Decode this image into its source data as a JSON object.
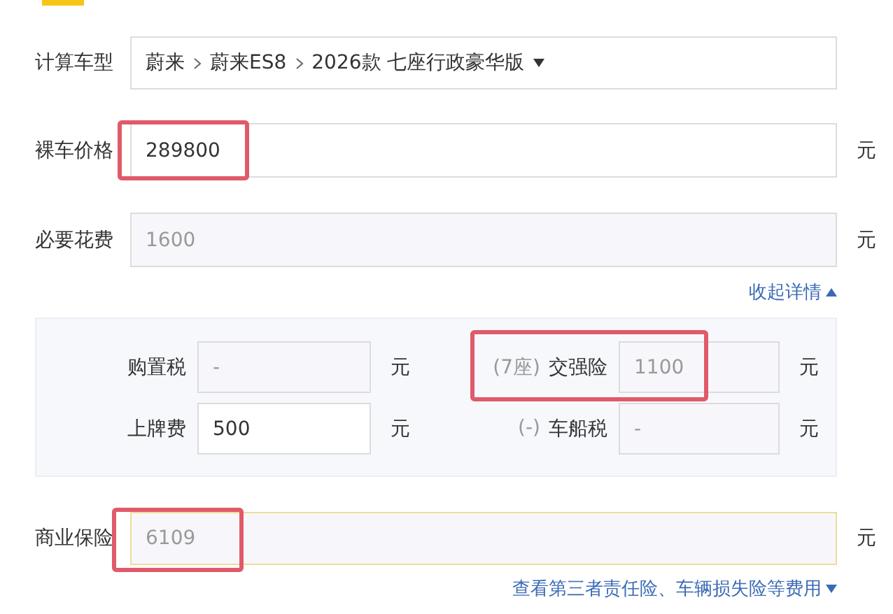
{
  "model_row": {
    "label": "计算车型",
    "path": [
      "蔚来",
      "蔚来ES8",
      "2026款 七座行政豪华版"
    ]
  },
  "price_rows": [
    {
      "label": "裸车价格",
      "value": "289800",
      "unit": "元",
      "disabled": false,
      "focused": false,
      "annotated": true
    },
    {
      "label": "必要花费",
      "value": "1600",
      "unit": "元",
      "disabled": true,
      "focused": false,
      "annotated": false
    }
  ],
  "collapse_link": {
    "label": "收起详情",
    "expanded": true
  },
  "details": [
    {
      "label": "购置税",
      "value": "-",
      "unit": "元",
      "disabled": true,
      "annotated": false
    },
    {
      "prefix": "(7座)",
      "label": "交强险",
      "value": "1100",
      "unit": "元",
      "disabled": true,
      "annotated": true
    },
    {
      "label": "上牌费",
      "value": "500",
      "unit": "元",
      "disabled": false,
      "annotated": false
    },
    {
      "prefix": "(-)",
      "label": "车船税",
      "value": "-",
      "unit": "元",
      "disabled": true,
      "annotated": false
    }
  ],
  "insurance_row": {
    "label": "商业保险",
    "value": "6109",
    "unit": "元",
    "disabled": true,
    "focused": true,
    "annotated": true
  },
  "insurance_link": {
    "label": "查看第三者责任险、车辆损失险等费用",
    "expanded": false
  }
}
